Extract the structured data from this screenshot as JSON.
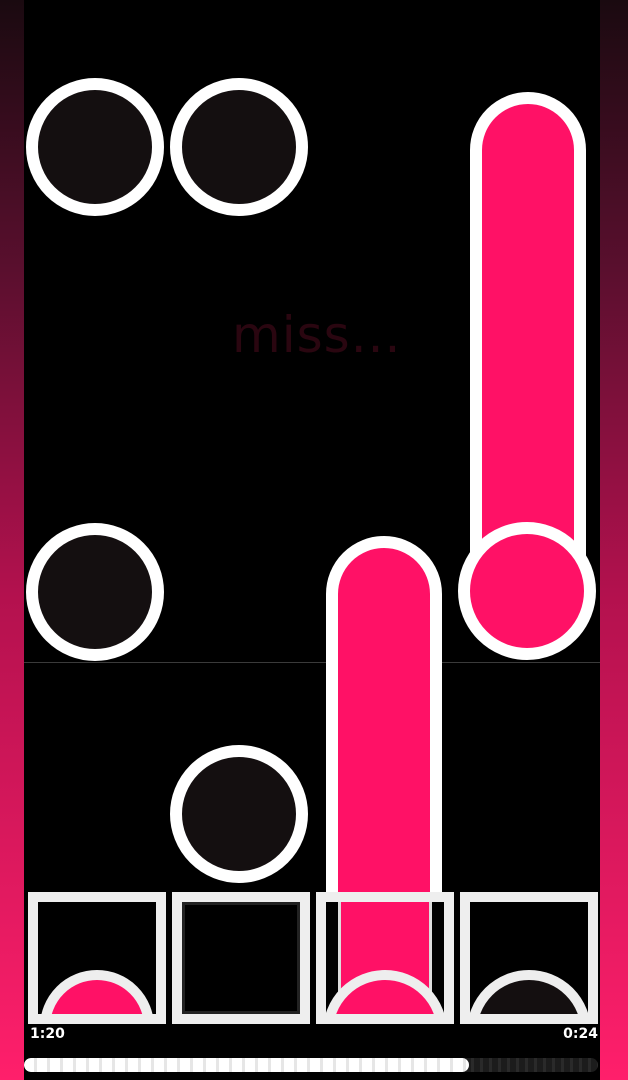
{
  "game": {
    "judgement_text": "miss...",
    "time_elapsed": "1:20",
    "time_remaining": "0:24",
    "progress_fraction": 0.775,
    "lanes": 4
  },
  "colors": {
    "accent": "#ff1166",
    "note_outline": "#ffffff",
    "note_fill": "#140f10",
    "background": "#000000"
  }
}
